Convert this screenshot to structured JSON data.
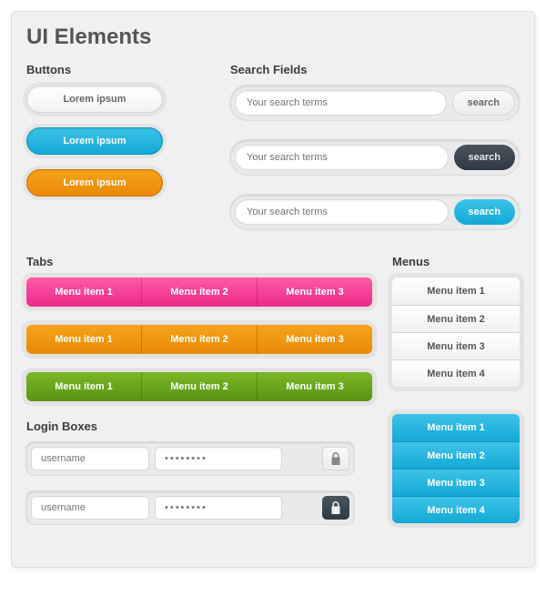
{
  "title": "UI Elements",
  "sections": {
    "buttons": "Buttons",
    "search": "Search Fields",
    "tabs": "Tabs",
    "menus": "Menus",
    "login": "Login Boxes"
  },
  "buttons": {
    "white": {
      "label": "Lorem ipsum",
      "color": "#f3f3f3"
    },
    "blue": {
      "label": "Lorem ipsum",
      "color": "#13a9d6"
    },
    "orange": {
      "label": "Lorem ipsum",
      "color": "#e98a06"
    }
  },
  "search": {
    "placeholder": "Your search terms",
    "button_label": "search",
    "rows": [
      {
        "style": "light"
      },
      {
        "style": "dark"
      },
      {
        "style": "blue"
      }
    ]
  },
  "tabs": {
    "pink": {
      "items": [
        "Menu item 1",
        "Menu item 2",
        "Menu item 3"
      ],
      "color": "#ec2a88"
    },
    "orange": {
      "items": [
        "Menu item 1",
        "Menu item 2",
        "Menu item 3"
      ],
      "color": "#e98a06"
    },
    "green": {
      "items": [
        "Menu item 1",
        "Menu item 2",
        "Menu item 3"
      ],
      "color": "#5a9412"
    }
  },
  "menus": {
    "white": {
      "items": [
        "Menu item 1",
        "Menu item 2",
        "Menu item 3",
        "Menu item 4"
      ],
      "color": "#f1f1f1"
    },
    "blue": {
      "items": [
        "Menu item 1",
        "Menu item 2",
        "Menu item 3",
        "Menu item 4"
      ],
      "color": "#13a9d6"
    }
  },
  "login": {
    "username_placeholder": "username",
    "password_mask": "••••••••",
    "rows": [
      {
        "lock_style": "light"
      },
      {
        "lock_style": "dark"
      }
    ]
  }
}
